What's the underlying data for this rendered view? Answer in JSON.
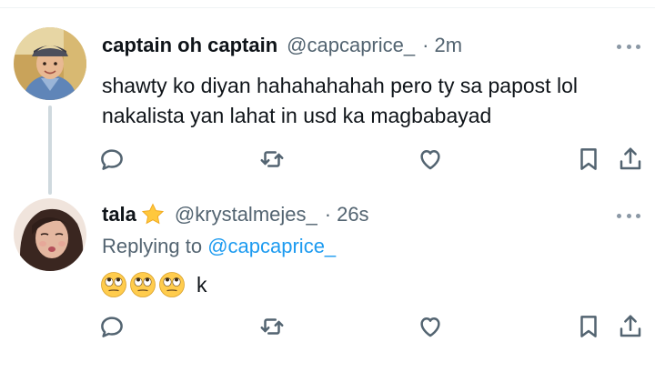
{
  "tweets": [
    {
      "display_name": "captain oh captain",
      "handle": "@capcaprice_",
      "separator": "·",
      "time": "2m",
      "text_lines": [
        "shawty ko diyan hahahahahah pero ty sa papost lol",
        "nakalista yan lahat in usd ka magbabayad"
      ]
    },
    {
      "display_name": "tala",
      "badge": "star-emoji",
      "handle": "@krystalmejes_",
      "separator": "·",
      "time": "26s",
      "replying_prefix": "Replying to",
      "replying_mention": "@capcaprice_",
      "text": "k",
      "emoji": [
        "face-with-rolling-eyes",
        "face-with-rolling-eyes",
        "face-with-rolling-eyes"
      ]
    }
  ],
  "icons": {
    "reply": "reply-icon",
    "retweet": "retweet-icon",
    "like": "like-icon",
    "bookmark": "bookmark-icon",
    "share": "share-icon",
    "more": "more-icon"
  },
  "colors": {
    "text": "#0f1419",
    "secondary": "#536471",
    "link": "#1d9bf0",
    "thread_line": "#cfd9de"
  }
}
